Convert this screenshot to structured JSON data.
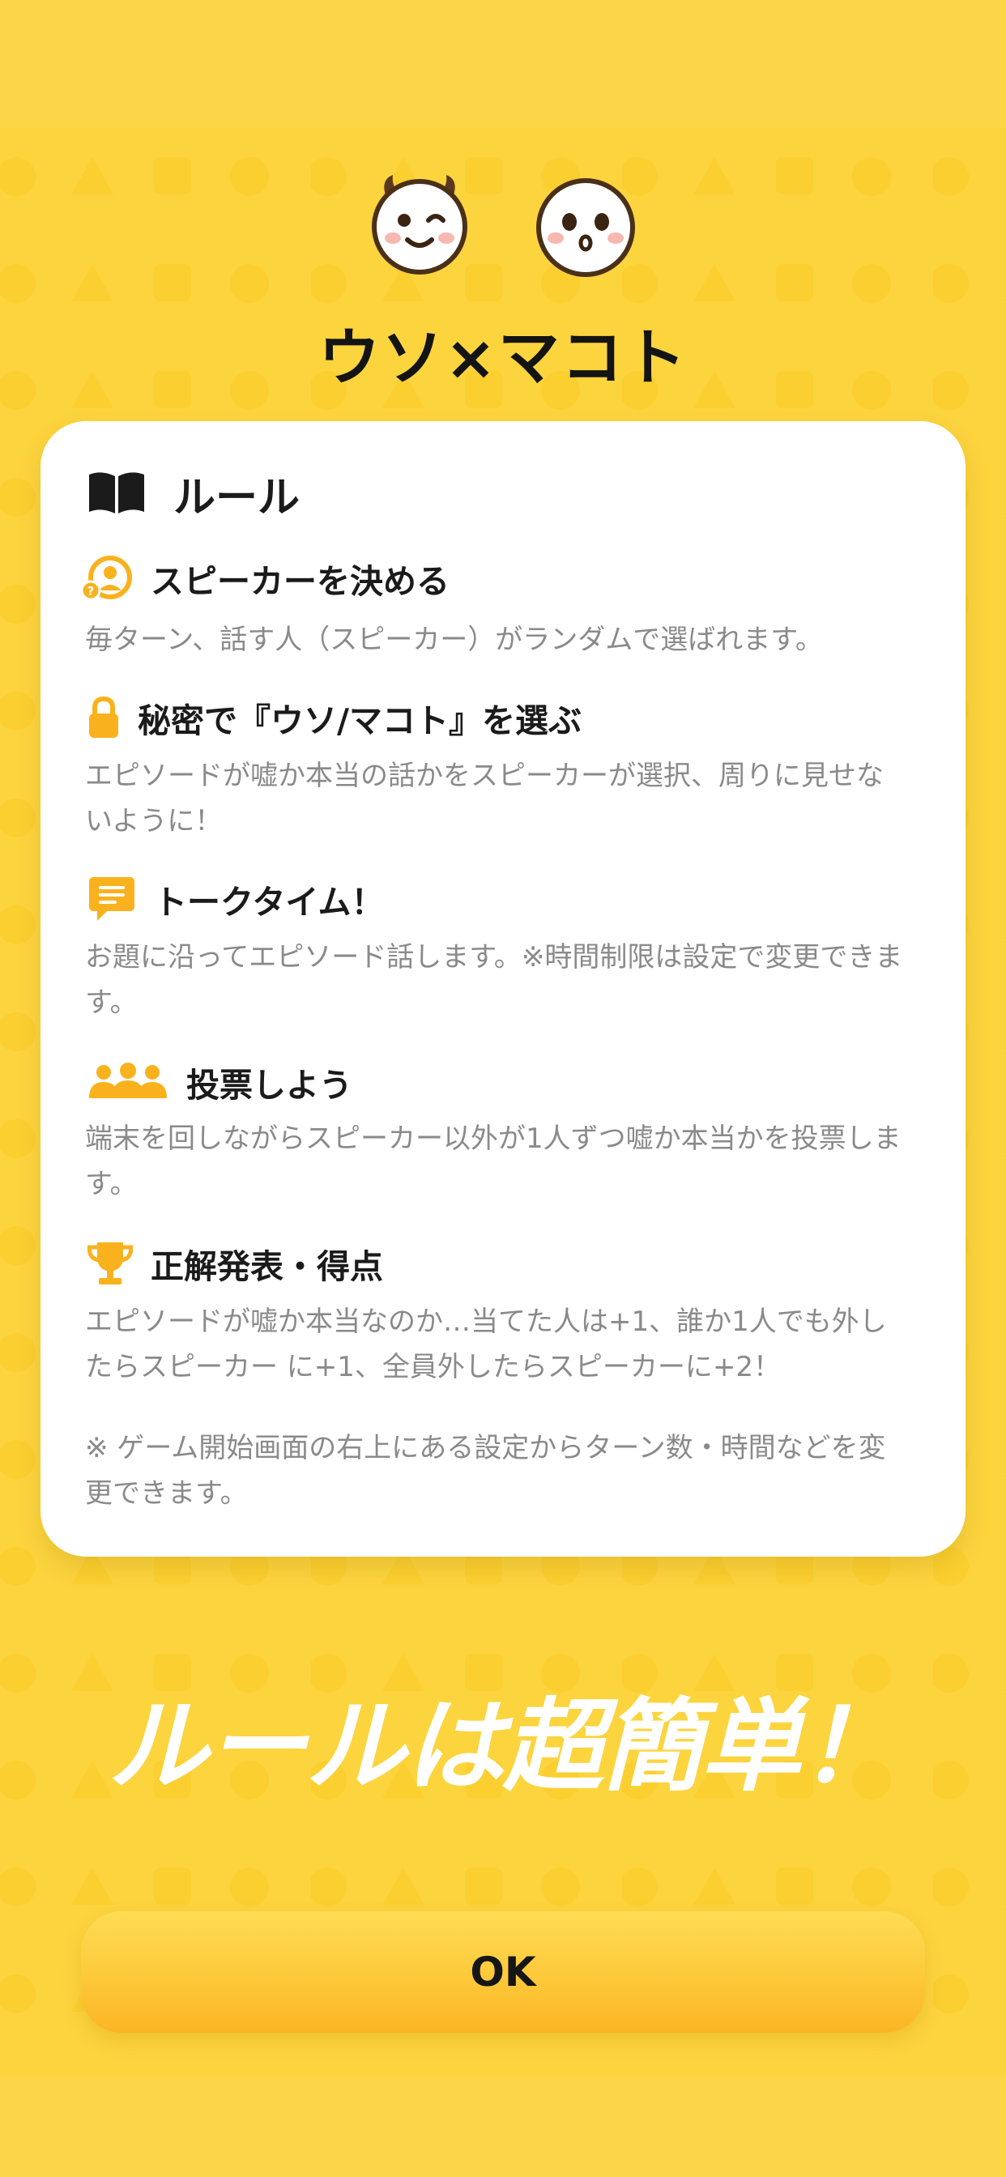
{
  "app_title": "ウソ×マコト",
  "rules_card": {
    "title": "ルール",
    "sections": [
      {
        "title": "スピーカーを決める",
        "description": "毎ターン、話す人（スピーカー）がランダムで選ばれます。",
        "icon": "speaker-select-icon"
      },
      {
        "title": "秘密で『ウソ/マコト』を選ぶ",
        "description": "エピソードが嘘か本当の話かをスピーカーが選択、周りに見せないように！",
        "icon": "lock-icon"
      },
      {
        "title": "トークタイム！",
        "description": "お題に沿ってエピソード話します。※時間制限は設定で変更できます。",
        "icon": "chat-bubble-icon"
      },
      {
        "title": "投票しよう",
        "description": "端末を回しながらスピーカー以外が1人ずつ嘘か本当かを投票します。",
        "icon": "group-icon"
      },
      {
        "title": "正解発表・得点",
        "description": "エピソードが嘘か本当なのか…当てた人は+1、誰か1人でも外したらスピーカー に+1、全員外したらスピーカーに+2！",
        "icon": "trophy-icon"
      }
    ],
    "note": "※ ゲーム開始画面の右上にある設定からターン数・時間などを変更できます。"
  },
  "tagline": "ルールは超簡単！",
  "ok_button": {
    "label": "OK"
  },
  "colors": {
    "background": "#fcd43e",
    "accent": "#f9b21d",
    "card": "#ffffff",
    "text_primary": "#1b1b1b",
    "text_secondary": "#8a8a8a"
  }
}
